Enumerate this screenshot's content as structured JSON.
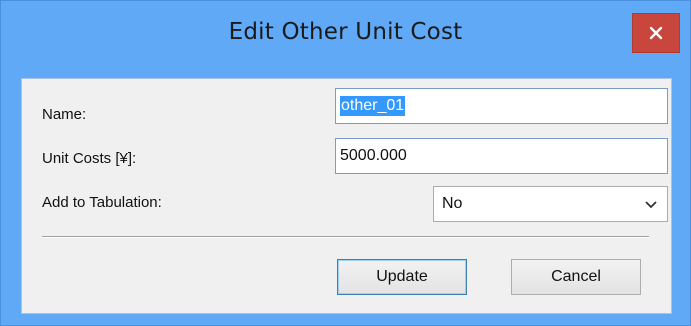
{
  "window": {
    "title": "Edit Other Unit Cost",
    "close_icon": "close-icon",
    "colors": {
      "titlebar": "#5fa9f6",
      "close": "#c9463d",
      "selection": "#3399ff"
    }
  },
  "form": {
    "name_label": "Name:",
    "name_value": "other_01",
    "unit_costs_label": "Unit Costs [¥]:",
    "unit_costs_value": "5000.000",
    "tabulation_label": "Add to Tabulation:",
    "tabulation_value": "No",
    "tabulation_icon": "chevron-down-icon"
  },
  "buttons": {
    "update_label": "Update",
    "cancel_label": "Cancel"
  }
}
